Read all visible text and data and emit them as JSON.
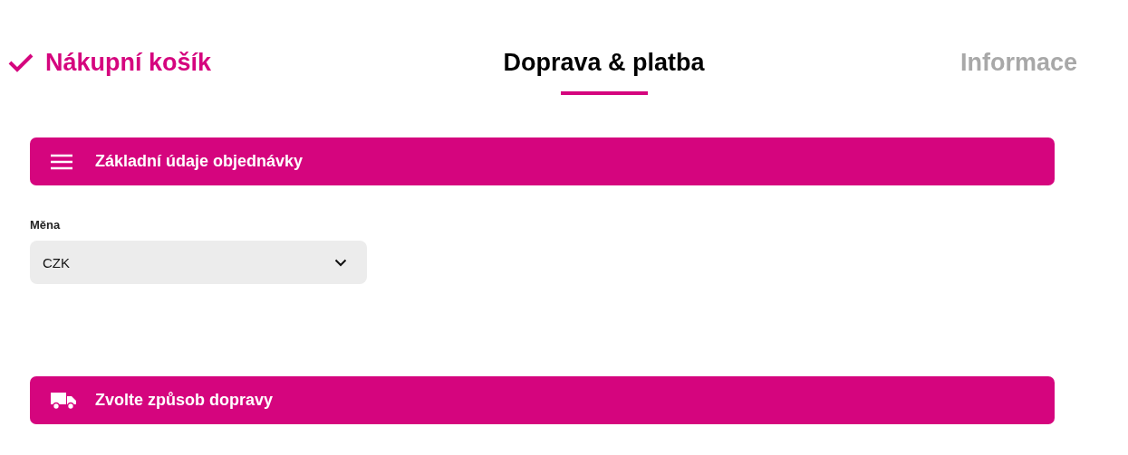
{
  "steps": [
    {
      "label": "Nákupní košík",
      "completed": true,
      "selected": false
    },
    {
      "label": "Doprava & platba",
      "completed": false,
      "selected": true
    },
    {
      "label": "Informace",
      "completed": false,
      "selected": false
    }
  ],
  "sections": [
    {
      "title": "Základní údaje objednávky",
      "kind": "menu",
      "fields": [
        {
          "label": "Měna",
          "value": "CZK"
        }
      ]
    },
    {
      "title": "Zvolte způsob dopravy",
      "kind": "truck"
    }
  ]
}
